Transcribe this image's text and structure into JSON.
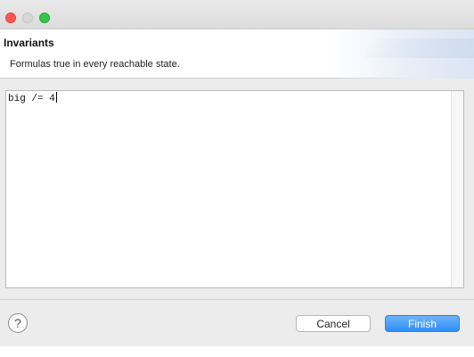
{
  "window": {
    "title": ""
  },
  "header": {
    "title": "Invariants",
    "description": "Formulas true in every reachable state."
  },
  "editor": {
    "value": "big /= 4"
  },
  "footer": {
    "help_glyph": "?",
    "cancel_label": "Cancel",
    "finish_label": "Finish"
  },
  "colors": {
    "accent": "#3a94f7",
    "close": "#fc5753",
    "minimize_disabled": "#d6d6d6",
    "maximize": "#33c748"
  }
}
